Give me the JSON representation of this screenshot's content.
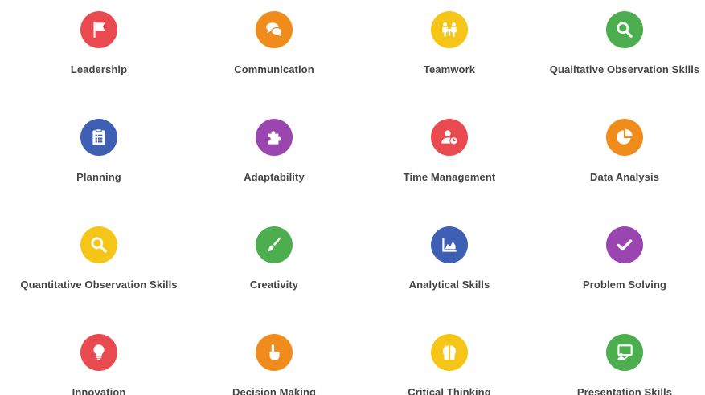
{
  "skills": [
    {
      "label": "Leadership",
      "color": "#e84a4f",
      "icon": "flag-icon"
    },
    {
      "label": "Communication",
      "color": "#f08c1c",
      "icon": "chat-bubbles-icon"
    },
    {
      "label": "Teamwork",
      "color": "#f5c518",
      "icon": "team-meeting-icon"
    },
    {
      "label": "Qualitative Observation Skills",
      "color": "#4cae4f",
      "icon": "magnifier-icon"
    },
    {
      "label": "Planning",
      "color": "#3f5fb5",
      "icon": "clipboard-icon"
    },
    {
      "label": "Adaptability",
      "color": "#9b46b0",
      "icon": "puzzle-icon"
    },
    {
      "label": "Time Management",
      "color": "#e84a4f",
      "icon": "user-clock-icon"
    },
    {
      "label": "Data Analysis",
      "color": "#f08c1c",
      "icon": "pie-chart-icon"
    },
    {
      "label": "Quantitative Observation Skills",
      "color": "#f5c518",
      "icon": "magnifier-icon"
    },
    {
      "label": "Creativity",
      "color": "#4cae4f",
      "icon": "paintbrush-icon"
    },
    {
      "label": "Analytical Skills",
      "color": "#3f5fb5",
      "icon": "area-chart-icon"
    },
    {
      "label": "Problem Solving",
      "color": "#9b46b0",
      "icon": "checkmark-icon"
    },
    {
      "label": "Innovation",
      "color": "#e84a4f",
      "icon": "lightbulb-icon"
    },
    {
      "label": "Decision Making",
      "color": "#f08c1c",
      "icon": "pointing-hand-icon"
    },
    {
      "label": "Critical Thinking",
      "color": "#f5c518",
      "icon": "brain-icon"
    },
    {
      "label": "Presentation Skills",
      "color": "#4cae4f",
      "icon": "presentation-board-icon"
    }
  ]
}
